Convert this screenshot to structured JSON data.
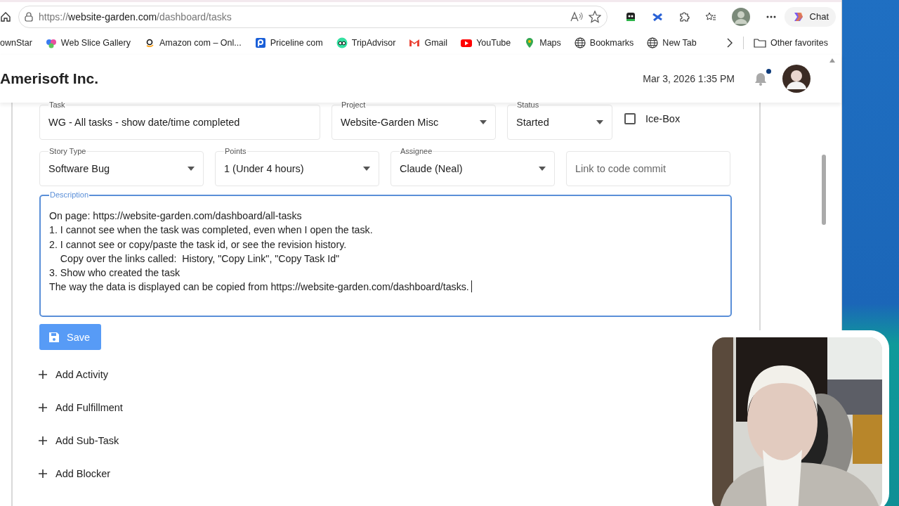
{
  "browser": {
    "url": {
      "scheme": "https://",
      "host": "website-garden.com",
      "path": "/dashboard/tasks"
    },
    "chat_label": "Chat",
    "bookmarks": [
      {
        "label": "ownStar"
      },
      {
        "label": "Web Slice Gallery"
      },
      {
        "label": "Amazon com – Onl..."
      },
      {
        "label": "Priceline com"
      },
      {
        "label": "TripAdvisor"
      },
      {
        "label": "Gmail"
      },
      {
        "label": "YouTube"
      },
      {
        "label": "Maps"
      },
      {
        "label": "Bookmarks"
      },
      {
        "label": "New Tab"
      }
    ],
    "other_favorites": "Other favorites"
  },
  "header": {
    "brand": "Amerisoft Inc.",
    "datetime": "Mar 3, 2026 1:35 PM",
    "unread_dot": true
  },
  "form": {
    "main_fields": [
      {
        "kind": "text",
        "label": "Task",
        "value": "WG - All tasks - show date/time completed"
      },
      {
        "kind": "select",
        "label": "Project",
        "value": "Website-Garden Misc"
      },
      {
        "kind": "select",
        "label": "Status",
        "value": "Started"
      },
      {
        "kind": "checkbox",
        "label": "Ice-Box",
        "checked": false
      }
    ],
    "detail_fields": [
      {
        "kind": "select",
        "label": "Story Type",
        "value": "Software Bug"
      },
      {
        "kind": "select",
        "label": "Points",
        "value": "1 (Under 4 hours)"
      },
      {
        "kind": "select",
        "label": "Assignee",
        "value": "Claude (Neal)"
      },
      {
        "kind": "text",
        "placeholder": "Link to code commit"
      }
    ],
    "description": {
      "label": "Description",
      "focused": true,
      "lines": [
        "On page: https://website-garden.com/dashboard/all-tasks",
        "1. I cannot see when the task was completed, even when I open the task.",
        "2. I cannot see or copy/paste the task id, or see the revision history.",
        "    Copy over the links called:  History, \"Copy Link\", \"Copy Task Id\"",
        "3. Show who created the task",
        "The way the data is displayed can be copied from https://website-garden.com/dashboard/tasks."
      ]
    },
    "save_label": "Save",
    "sections": [
      "Add Activity",
      "Add Fulfillment",
      "Add Sub-Task",
      "Add Blocker"
    ]
  }
}
